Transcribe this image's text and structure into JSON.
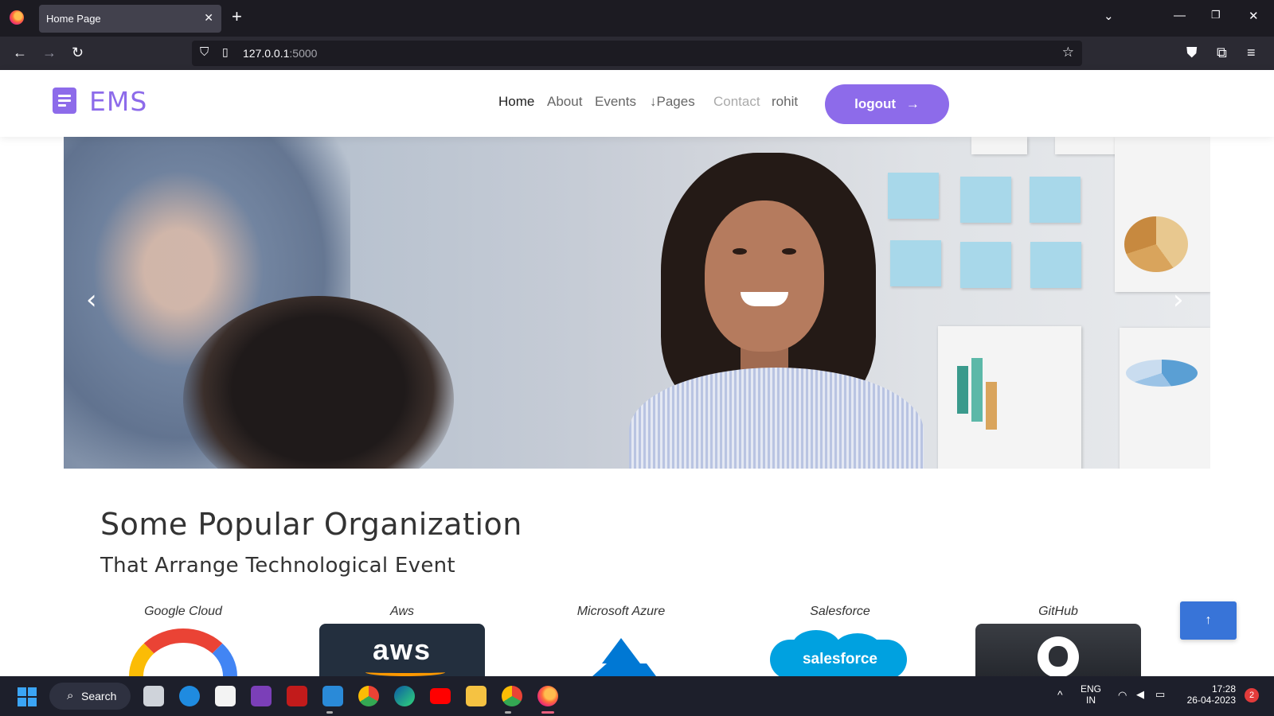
{
  "browser": {
    "tab_title": "Home Page",
    "url_host": "127.0.0.1",
    "url_port": ":5000"
  },
  "site": {
    "brand": "EMS",
    "nav": [
      {
        "label": "Home",
        "state": "active"
      },
      {
        "label": "About",
        "state": "normal"
      },
      {
        "label": "Events",
        "state": "normal"
      },
      {
        "label": "↓Pages",
        "state": "normal"
      },
      {
        "label": "Contact",
        "state": "muted"
      },
      {
        "label": "rohit",
        "state": "normal"
      }
    ],
    "logout_label": "logout",
    "logout_arrow": "→",
    "accent": "#8d6bea"
  },
  "hero": {
    "prev_arrow": "‹",
    "next_arrow": "›"
  },
  "section": {
    "title": "Some Popular Organization",
    "subtitle": "That Arrange Technological Event",
    "orgs": [
      {
        "name": "Google Cloud"
      },
      {
        "name": "Aws",
        "logo_text": "aws"
      },
      {
        "name": "Microsoft Azure"
      },
      {
        "name": "Salesforce",
        "logo_text": "salesforce"
      },
      {
        "name": "GitHub"
      }
    ],
    "to_top": "↑"
  },
  "taskbar": {
    "search_label": "Search",
    "lang_line1": "ENG",
    "lang_line2": "IN",
    "time": "17:28",
    "date": "26-04-2023",
    "notifications": "2"
  }
}
